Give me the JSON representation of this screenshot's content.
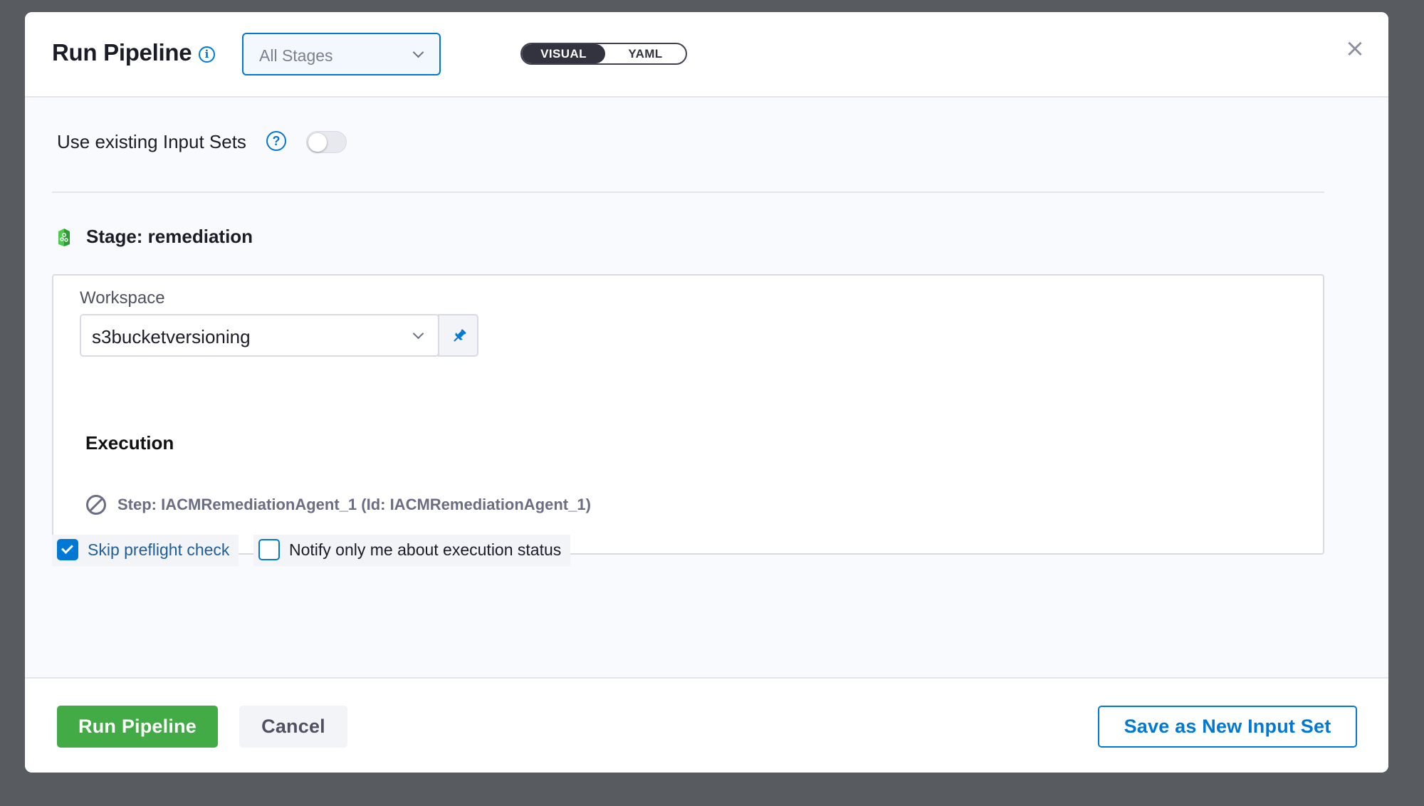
{
  "header": {
    "title": "Run Pipeline",
    "stage_select": {
      "value": "All Stages"
    },
    "view_toggle": {
      "visual": "VISUAL",
      "yaml": "YAML",
      "selected": "VISUAL"
    },
    "close": "×"
  },
  "input_sets": {
    "label": "Use existing Input Sets",
    "help": "?",
    "enabled": false
  },
  "stage": {
    "title": "Stage: remediation",
    "workspace": {
      "label": "Workspace",
      "value": "s3bucketversioning"
    },
    "execution": {
      "title": "Execution",
      "step": "Step: IACMRemediationAgent_1 (Id: IACMRemediationAgent_1)"
    }
  },
  "options": {
    "skip_preflight": {
      "label": "Skip preflight check",
      "checked": true
    },
    "notify_me": {
      "label": "Notify only me about execution status",
      "checked": false
    }
  },
  "footer": {
    "run_label": "Run Pipeline",
    "cancel_label": "Cancel",
    "save_label": "Save as New Input Set"
  },
  "colors": {
    "accent": "#0278d5",
    "run_button": "#42ab45",
    "overlay": "#585c61"
  },
  "icons": [
    "info-icon",
    "chevron-down-icon",
    "close-icon",
    "help-icon",
    "stage-icon",
    "pin-icon",
    "ban-icon",
    "check-icon"
  ]
}
